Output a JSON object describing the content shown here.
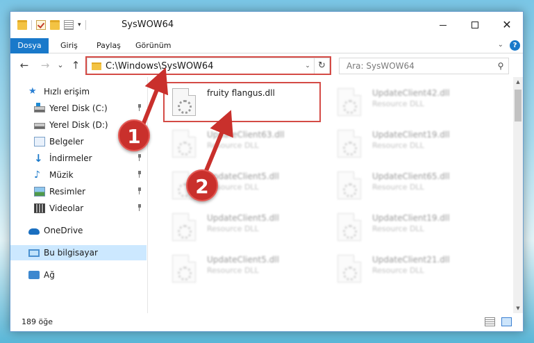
{
  "window": {
    "title": "SysWOW64",
    "controls": {
      "minimize": "",
      "maximize": "",
      "close": "✕"
    }
  },
  "ribbon": {
    "tabs": [
      "Dosya",
      "Giriş",
      "Paylaş",
      "Görünüm"
    ],
    "help": "?"
  },
  "nav": {
    "back": "←",
    "forward": "→",
    "recent": "⌄",
    "up": "↑",
    "address": "C:\\Windows\\SysWOW64",
    "search_placeholder": "Ara: SysWOW64"
  },
  "sidebar": {
    "items": [
      {
        "label": "Hızlı erişim",
        "icon": "star-icon"
      },
      {
        "label": "Yerel Disk (C:)",
        "icon": "drive-c-icon"
      },
      {
        "label": "Yerel Disk (D:)",
        "icon": "drive-d-icon"
      },
      {
        "label": "Belgeler",
        "icon": "documents-icon"
      },
      {
        "label": "İndirmeler",
        "icon": "downloads-icon"
      },
      {
        "label": "Müzik",
        "icon": "music-icon"
      },
      {
        "label": "Resimler",
        "icon": "pictures-icon"
      },
      {
        "label": "Videolar",
        "icon": "videos-icon"
      },
      {
        "label": "OneDrive",
        "icon": "onedrive-icon"
      },
      {
        "label": "Bu bilgisayar",
        "icon": "this-pc-icon"
      },
      {
        "label": "Ağ",
        "icon": "network-icon"
      }
    ]
  },
  "files": [
    {
      "name": "fruity flangus.dll",
      "type": ""
    },
    {
      "name": "UpdateClient42.dll",
      "type": "Resource DLL"
    },
    {
      "name": "UpdateClient63.dll",
      "type": "Resource DLL"
    },
    {
      "name": "UpdateClient19.dll",
      "type": "Resource DLL"
    },
    {
      "name": "UpdateClient5.dll",
      "type": "Resource DLL"
    },
    {
      "name": "UpdateClient65.dll",
      "type": "Resource DLL"
    },
    {
      "name": "UpdateClient5.dll",
      "type": "Resource DLL"
    },
    {
      "name": "UpdateClient19.dll",
      "type": "Resource DLL"
    },
    {
      "name": "UpdateClient5.dll",
      "type": "Resource DLL"
    },
    {
      "name": "UpdateClient21.dll",
      "type": "Resource DLL"
    }
  ],
  "status": {
    "count": "189 öğe"
  },
  "annotations": {
    "step1": "1",
    "step2": "2",
    "color": "#d44a45"
  }
}
